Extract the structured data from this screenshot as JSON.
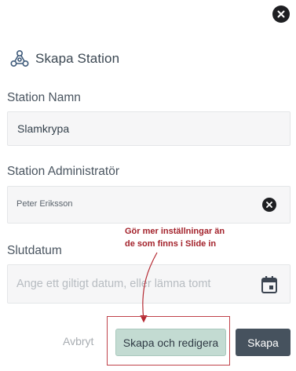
{
  "dialog": {
    "title": "Skapa Station",
    "logo_icon": "station-network-icon",
    "close_icon": "close-icon"
  },
  "fields": {
    "name": {
      "label": "Station Namn",
      "value": "Slamkrypa"
    },
    "admin": {
      "label": "Station Administratör",
      "value": "Peter Eriksson",
      "clear_icon": "clear-icon"
    },
    "end_date": {
      "label": "Slutdatum",
      "placeholder": "Ange ett giltigt datum, eller lämna tomt",
      "icon": "calendar-icon"
    }
  },
  "annotation": {
    "line1": "Gör mer inställningar än",
    "line2": "de som finns i Slide in",
    "color": "#a3222b"
  },
  "buttons": {
    "cancel": "Avbryt",
    "create_and_edit": "Skapa och redigera",
    "create": "Skapa"
  },
  "colors": {
    "accent_green": "#c3dbd2",
    "primary_dark": "#46525e",
    "annotation_red": "#c0424a"
  }
}
